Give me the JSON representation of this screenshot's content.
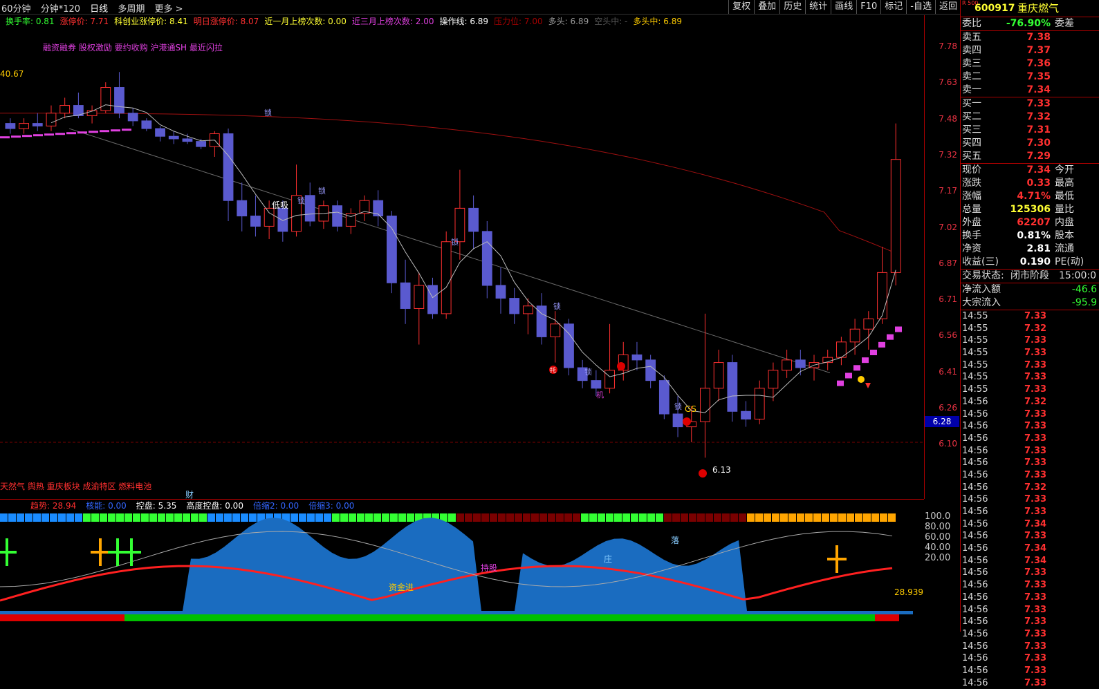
{
  "toolbar": {
    "items": [
      "60分钟",
      "分钟*120",
      "日线",
      "多周期",
      "更多 >"
    ],
    "active": "日线",
    "right_buttons": [
      "复权",
      "叠加",
      "历史",
      "统计",
      "画线",
      "F10",
      "标记",
      "-自选",
      "返回"
    ]
  },
  "indicators": [
    {
      "label": "换手率: 0.81",
      "color": "#33ff33"
    },
    {
      "label": "涨停价: 7.71",
      "color": "#ff3030"
    },
    {
      "label": "科创业涨停价: 8.41",
      "color": "#ffff33"
    },
    {
      "label": "明日涨停价: 8.07",
      "color": "#ff3030"
    },
    {
      "label": "近一月上榜次数: 0.00",
      "color": "#ffff33"
    },
    {
      "label": "近三月上榜次数: 2.00",
      "color": "#e040e0"
    },
    {
      "label": "操作线: 6.89",
      "color": "#ffffff"
    },
    {
      "label": "压力位: 7.00",
      "color": "#a00000"
    },
    {
      "label": "多头: 6.89",
      "color": "#9a9a9a"
    },
    {
      "label": "空头中: -",
      "color": "#555555"
    },
    {
      "label": "多头中: 6.89",
      "color": "#ffcc00"
    }
  ],
  "tags_line": "融资融券 股权激励 要约收购 沪港通SH 最近闪拉",
  "bottom_tags": "天然气 舆热 重庆板块 成渝特区 燃料电池",
  "chart_labels": {
    "left_value": "40.67",
    "low_label": "6.13",
    "current_price_tag": "6.28",
    "cai": "财",
    "tuo": "托",
    "ji": "机",
    "gs": "GS",
    "low_buy": "低吸",
    "lock": "锁"
  },
  "price_axis": [
    "7.78",
    "7.63",
    "7.48",
    "7.32",
    "7.17",
    "7.02",
    "6.87",
    "6.71",
    "6.56",
    "6.41",
    "6.26",
    "6.10"
  ],
  "sub_axis": [
    "100.0",
    "80.00",
    "60.00",
    "40.00",
    "20.00"
  ],
  "sub_legend": [
    {
      "label": "趋势: 28.94",
      "color": "#ff3030"
    },
    {
      "label": "核能: 0.00",
      "color": "#3366ff"
    },
    {
      "label": "控盘: 5.35",
      "color": "#ffffff"
    },
    {
      "label": "高度控盘: 0.00",
      "color": "#ffffff"
    },
    {
      "label": "倍缩2: 0.00",
      "color": "#3366ff"
    },
    {
      "label": "倍缩3: 0.00",
      "color": "#3366ff"
    }
  ],
  "sub_labels": {
    "sub_value": "28.939",
    "chi_gu": "持股",
    "zi_jin": "资金进",
    "zhuang": "庄",
    "luo": "落"
  },
  "quote": {
    "code": "600917",
    "name": "重庆燃气",
    "tag": "R 500",
    "wei_bi": {
      "label": "委比",
      "value": "-76.90%",
      "label2": "委差"
    },
    "sell": [
      {
        "label": "卖五",
        "price": "7.38"
      },
      {
        "label": "卖四",
        "price": "7.37"
      },
      {
        "label": "卖三",
        "price": "7.36"
      },
      {
        "label": "卖二",
        "price": "7.35"
      },
      {
        "label": "卖一",
        "price": "7.34"
      }
    ],
    "buy": [
      {
        "label": "买一",
        "price": "7.33"
      },
      {
        "label": "买二",
        "price": "7.32"
      },
      {
        "label": "买三",
        "price": "7.31"
      },
      {
        "label": "买四",
        "price": "7.30"
      },
      {
        "label": "买五",
        "price": "7.29"
      }
    ],
    "stats": [
      {
        "label": "现价",
        "value": "7.34",
        "label2": "今开",
        "color": "#ff3030"
      },
      {
        "label": "涨跌",
        "value": "0.33",
        "label2": "最高",
        "color": "#ff3030"
      },
      {
        "label": "涨幅",
        "value": "4.71%",
        "label2": "最低",
        "color": "#ff3030"
      },
      {
        "label": "总量",
        "value": "125306",
        "label2": "量比",
        "color": "#ffff33"
      },
      {
        "label": "外盘",
        "value": "62207",
        "label2": "内盘",
        "color": "#ff3030"
      },
      {
        "label": "换手",
        "value": "0.81%",
        "label2": "股本",
        "color": "#ffffff"
      },
      {
        "label": "净资",
        "value": "2.81",
        "label2": "流通",
        "color": "#ffffff"
      },
      {
        "label": "收益(三)",
        "value": "0.190",
        "label2": "PE(动)",
        "color": "#ffffff"
      }
    ],
    "trade_status": {
      "label": "交易状态:",
      "value": "闭市阶段",
      "time": "15:00:0"
    },
    "net_flow": {
      "label": "净流入额",
      "value": "-46.6"
    },
    "block_flow": {
      "label": "大宗流入",
      "value": "-95.9"
    },
    "ticks": [
      {
        "time": "14:55",
        "price": "7.33"
      },
      {
        "time": "14:55",
        "price": "7.32"
      },
      {
        "time": "14:55",
        "price": "7.33"
      },
      {
        "time": "14:55",
        "price": "7.33"
      },
      {
        "time": "14:55",
        "price": "7.33"
      },
      {
        "time": "14:55",
        "price": "7.33"
      },
      {
        "time": "14:55",
        "price": "7.33"
      },
      {
        "time": "14:56",
        "price": "7.32"
      },
      {
        "time": "14:56",
        "price": "7.33"
      },
      {
        "time": "14:56",
        "price": "7.33"
      },
      {
        "time": "14:56",
        "price": "7.33"
      },
      {
        "time": "14:56",
        "price": "7.33"
      },
      {
        "time": "14:56",
        "price": "7.33"
      },
      {
        "time": "14:56",
        "price": "7.33"
      },
      {
        "time": "14:56",
        "price": "7.32"
      },
      {
        "time": "14:56",
        "price": "7.33"
      },
      {
        "time": "14:56",
        "price": "7.33"
      },
      {
        "time": "14:56",
        "price": "7.34"
      },
      {
        "time": "14:56",
        "price": "7.33"
      },
      {
        "time": "14:56",
        "price": "7.34"
      },
      {
        "time": "14:56",
        "price": "7.34"
      },
      {
        "time": "14:56",
        "price": "7.33"
      },
      {
        "time": "14:56",
        "price": "7.33"
      },
      {
        "time": "14:56",
        "price": "7.33"
      },
      {
        "time": "14:56",
        "price": "7.33"
      },
      {
        "time": "14:56",
        "price": "7.33"
      },
      {
        "time": "14:56",
        "price": "7.33"
      },
      {
        "time": "14:56",
        "price": "7.33"
      },
      {
        "time": "14:56",
        "price": "7.33"
      },
      {
        "time": "14:56",
        "price": "7.33"
      },
      {
        "time": "14:56",
        "price": "7.33"
      }
    ]
  },
  "chart_data": {
    "type": "candlestick",
    "ylim": [
      6.1,
      7.78
    ],
    "candles": [
      [
        7.48,
        7.5,
        7.44,
        7.46
      ],
      [
        7.46,
        7.5,
        7.44,
        7.48
      ],
      [
        7.48,
        7.52,
        7.45,
        7.47
      ],
      [
        7.47,
        7.55,
        7.45,
        7.52
      ],
      [
        7.52,
        7.58,
        7.5,
        7.55
      ],
      [
        7.55,
        7.6,
        7.5,
        7.51
      ],
      [
        7.51,
        7.55,
        7.48,
        7.53
      ],
      [
        7.53,
        7.64,
        7.52,
        7.62
      ],
      [
        7.62,
        7.68,
        7.5,
        7.52
      ],
      [
        7.52,
        7.54,
        7.47,
        7.49
      ],
      [
        7.49,
        7.5,
        7.45,
        7.46
      ],
      [
        7.46,
        7.47,
        7.41,
        7.43
      ],
      [
        7.43,
        7.45,
        7.4,
        7.42
      ],
      [
        7.42,
        7.44,
        7.4,
        7.41
      ],
      [
        7.41,
        7.42,
        7.38,
        7.39
      ],
      [
        7.39,
        7.45,
        7.35,
        7.44
      ],
      [
        7.44,
        7.46,
        7.1,
        7.18
      ],
      [
        7.18,
        7.25,
        7.06,
        7.12
      ],
      [
        7.12,
        7.2,
        7.04,
        7.08
      ],
      [
        7.08,
        7.18,
        7.03,
        7.15
      ],
      [
        7.15,
        7.18,
        7.02,
        7.06
      ],
      [
        7.06,
        7.32,
        7.04,
        7.2
      ],
      [
        7.2,
        7.25,
        7.08,
        7.1
      ],
      [
        7.1,
        7.18,
        7.07,
        7.16
      ],
      [
        7.16,
        7.18,
        7.06,
        7.08
      ],
      [
        7.08,
        7.15,
        7.05,
        7.13
      ],
      [
        7.13,
        7.2,
        7.1,
        7.18
      ],
      [
        7.18,
        7.22,
        7.08,
        7.12
      ],
      [
        7.12,
        7.14,
        6.82,
        6.86
      ],
      [
        6.86,
        6.95,
        6.7,
        6.76
      ],
      [
        6.76,
        6.9,
        6.62,
        6.85
      ],
      [
        6.85,
        6.88,
        6.72,
        6.74
      ],
      [
        6.74,
        7.06,
        6.72,
        7.02
      ],
      [
        7.02,
        7.3,
        6.95,
        7.15
      ],
      [
        7.15,
        7.2,
        6.99,
        7.06
      ],
      [
        7.06,
        7.1,
        6.8,
        6.85
      ],
      [
        6.85,
        6.92,
        6.74,
        6.8
      ],
      [
        6.8,
        6.84,
        6.7,
        6.74
      ],
      [
        6.74,
        6.8,
        6.66,
        6.77
      ],
      [
        6.77,
        6.82,
        6.62,
        6.65
      ],
      [
        6.65,
        6.75,
        6.55,
        6.7
      ],
      [
        6.7,
        6.72,
        6.5,
        6.53
      ],
      [
        6.53,
        6.56,
        6.45,
        6.48
      ],
      [
        6.48,
        6.52,
        6.42,
        6.45
      ],
      [
        6.45,
        6.7,
        6.43,
        6.52
      ],
      [
        6.52,
        6.63,
        6.48,
        6.58
      ],
      [
        6.58,
        6.63,
        6.52,
        6.56
      ],
      [
        6.56,
        6.58,
        6.45,
        6.48
      ],
      [
        6.48,
        6.5,
        6.33,
        6.35
      ],
      [
        6.35,
        6.42,
        6.26,
        6.3
      ],
      [
        6.3,
        6.38,
        6.24,
        6.32
      ],
      [
        6.32,
        6.74,
        6.18,
        6.45
      ],
      [
        6.45,
        6.6,
        6.4,
        6.55
      ],
      [
        6.55,
        6.58,
        6.32,
        6.36
      ],
      [
        6.36,
        6.4,
        6.3,
        6.33
      ],
      [
        6.33,
        6.48,
        6.31,
        6.45
      ],
      [
        6.45,
        6.55,
        6.4,
        6.52
      ],
      [
        6.52,
        6.6,
        6.49,
        6.56
      ],
      [
        6.56,
        6.6,
        6.5,
        6.53
      ],
      [
        6.53,
        6.58,
        6.48,
        6.55
      ],
      [
        6.55,
        6.6,
        6.52,
        6.57
      ],
      [
        6.57,
        6.65,
        6.54,
        6.63
      ],
      [
        6.63,
        6.72,
        6.58,
        6.68
      ],
      [
        6.68,
        6.75,
        6.6,
        6.72
      ],
      [
        6.72,
        7.0,
        6.7,
        6.9
      ],
      [
        6.9,
        7.48,
        6.85,
        7.34
      ]
    ]
  }
}
